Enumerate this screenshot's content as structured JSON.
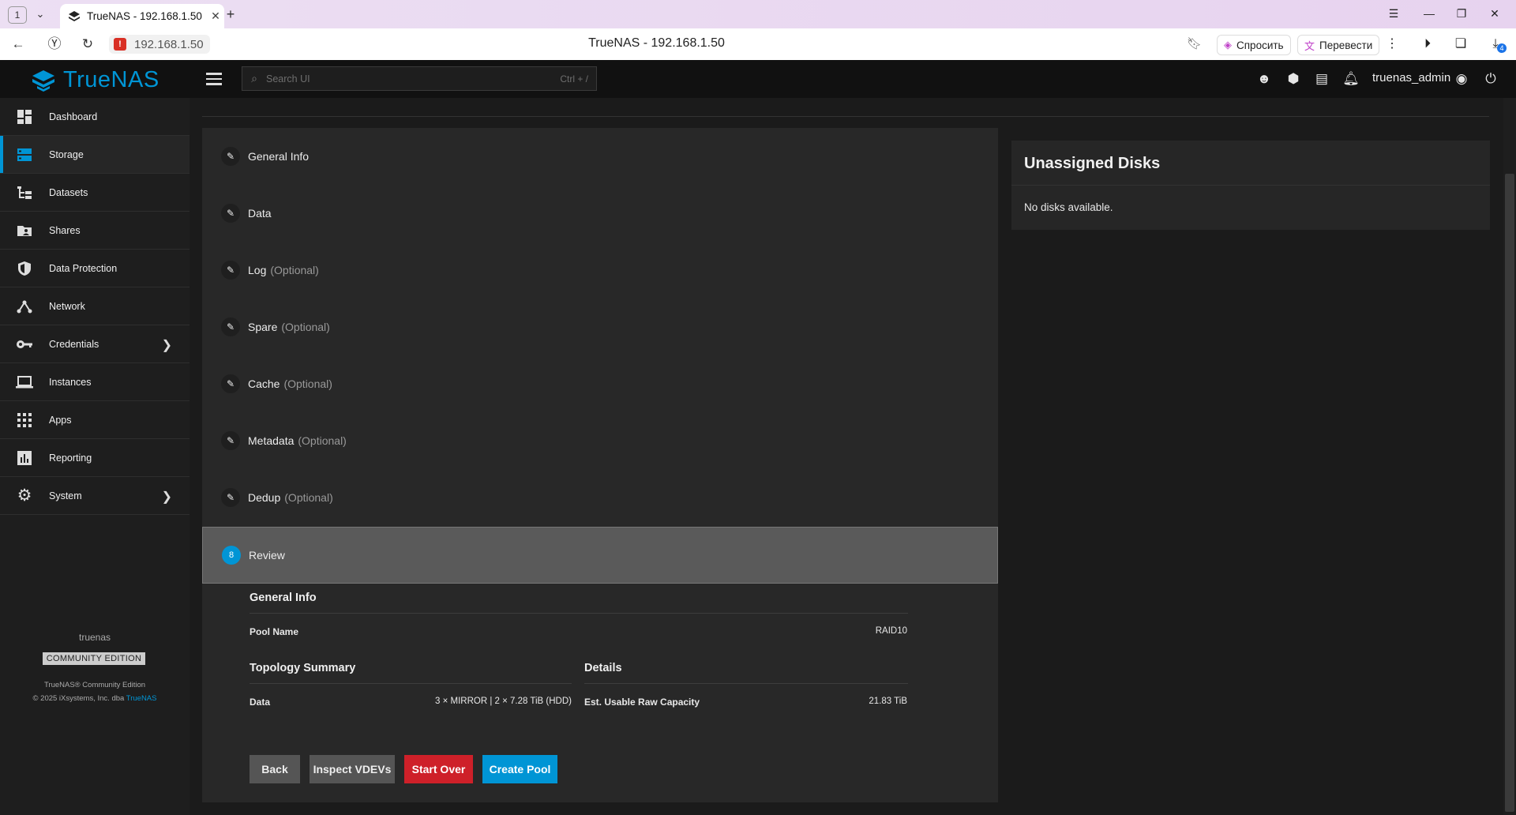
{
  "browser": {
    "tab_count": "1",
    "tab_title": "TrueNAS - 192.168.1.50",
    "url": "192.168.1.50",
    "page_title": "TrueNAS - 192.168.1.50",
    "ask_label": "Спросить",
    "translate_label": "Перевести",
    "downloads_badge": "4"
  },
  "topbar": {
    "logo": "TrueNAS",
    "search_placeholder": "Search UI",
    "search_hint": "Ctrl + /",
    "username": "truenas_admin"
  },
  "sidebar": {
    "items": [
      {
        "label": "Dashboard",
        "icon": "dashboard-icon"
      },
      {
        "label": "Storage",
        "icon": "storage-icon",
        "active": true
      },
      {
        "label": "Datasets",
        "icon": "datasets-icon"
      },
      {
        "label": "Shares",
        "icon": "shares-icon"
      },
      {
        "label": "Data Protection",
        "icon": "shield-icon"
      },
      {
        "label": "Network",
        "icon": "network-icon"
      },
      {
        "label": "Credentials",
        "icon": "key-icon"
      },
      {
        "label": "Instances",
        "icon": "laptop-icon"
      },
      {
        "label": "Apps",
        "icon": "apps-grid-icon"
      },
      {
        "label": "Reporting",
        "icon": "reporting-icon"
      },
      {
        "label": "System",
        "icon": "gear-icon"
      }
    ],
    "hostname": "truenas",
    "edition": "COMMUNITY EDITION",
    "copyright_line1": "TrueNAS® Community Edition",
    "copyright_line2": "© 2025 iXsystems, Inc. dba",
    "copyright_link": "TrueNAS"
  },
  "wizard": {
    "steps": [
      {
        "label": "General Info",
        "optional": ""
      },
      {
        "label": "Data",
        "optional": ""
      },
      {
        "label": "Log",
        "optional": "(Optional)"
      },
      {
        "label": "Spare",
        "optional": "(Optional)"
      },
      {
        "label": "Cache",
        "optional": "(Optional)"
      },
      {
        "label": "Metadata",
        "optional": "(Optional)"
      },
      {
        "label": "Dedup",
        "optional": "(Optional)"
      },
      {
        "label": "Review",
        "optional": "",
        "number": "8",
        "current": true
      }
    ],
    "review": {
      "general_info_title": "General Info",
      "pool_name_label": "Pool Name",
      "pool_name_value": "RAID10",
      "topology_title": "Topology Summary",
      "data_label": "Data",
      "data_value": "3 × MIRROR | 2 × 7.28 TiB (HDD)",
      "details_title": "Details",
      "capacity_label": "Est. Usable Raw Capacity",
      "capacity_value": "21.83 TiB"
    },
    "buttons": {
      "back": "Back",
      "inspect": "Inspect VDEVs",
      "start_over": "Start Over",
      "create": "Create Pool"
    }
  },
  "unassigned": {
    "title": "Unassigned Disks",
    "message": "No disks available."
  },
  "colors": {
    "accent": "#0095d5",
    "danger": "#ce2029",
    "background": "#1b1b1b"
  }
}
